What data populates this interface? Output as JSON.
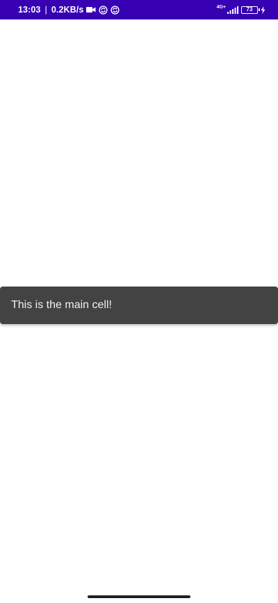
{
  "status_bar": {
    "time": "13:03",
    "separator": "|",
    "network_speed": "0.2KB/s",
    "icons_left": [
      "video-camera-icon",
      "sync-icon",
      "sync-icon"
    ],
    "network_type": "4G+",
    "battery_level": "73",
    "background_color": "#3700b3"
  },
  "snackbar": {
    "message": "This is the main cell!",
    "background_color": "#434343"
  },
  "navigation": {
    "handle": "gesture-handle"
  }
}
